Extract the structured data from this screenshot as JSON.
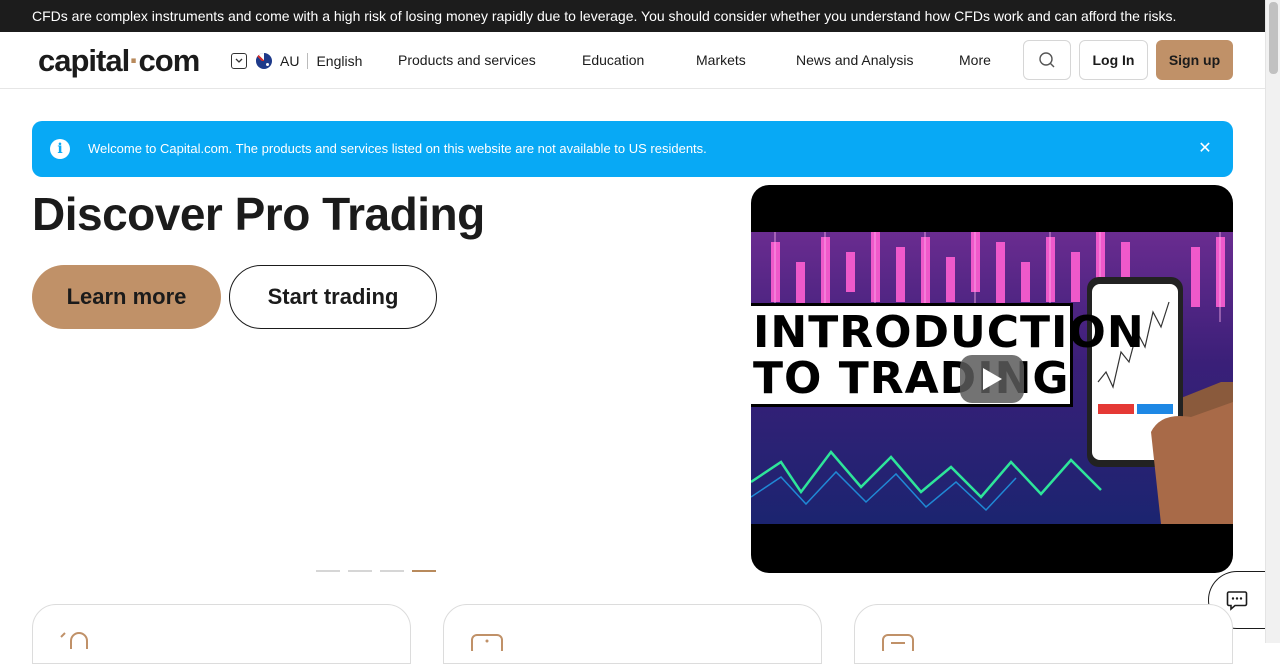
{
  "risk_warning": "CFDs are complex instruments and come with a high risk of losing money rapidly due to leverage. You should consider whether you understand how CFDs work and can afford the risks.",
  "header": {
    "logo_left": "capital",
    "logo_dot": "·",
    "logo_right": "com",
    "country": "AU",
    "language": "English",
    "nav": [
      "Products and services",
      "Education",
      "Markets",
      "News and Analysis",
      "More"
    ],
    "login": "Log In",
    "signup": "Sign up"
  },
  "notice": {
    "text": "Welcome to Capital.com. The products and services listed on this website are not available to US residents.",
    "close": "✕"
  },
  "hero": {
    "title": "Discover Pro Trading",
    "primary_cta": "Learn more",
    "secondary_cta": "Start trading",
    "slides": 4,
    "active_slide": 4
  },
  "video": {
    "caption_line1": "INTRODUCTION",
    "caption_line2": "TO TRADING"
  },
  "colors": {
    "brand": "#c09168",
    "notice_bg": "#08a9f5",
    "risk_bar": "#1c1c1c"
  }
}
